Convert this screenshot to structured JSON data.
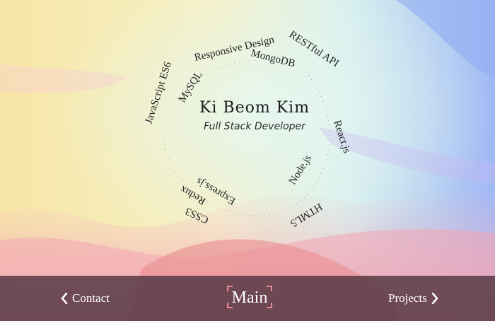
{
  "profile": {
    "name": "Ki Beom Kim",
    "role": "Full Stack Developer"
  },
  "skills": [
    "JavaScript ES6",
    "MySQL",
    "Responsive Design",
    "MongoDB",
    "RESTful API",
    "React.js",
    "Node.js",
    "HTML5",
    "Express.js",
    "Redux",
    "CSS3"
  ],
  "nav": {
    "left_label": "Contact",
    "center_label": "Main",
    "right_label": "Projects",
    "left_icon": "chevron-left-icon",
    "right_icon": "chevron-right-icon"
  },
  "colors": {
    "nav_bar": "#503440",
    "accent": "#e58b9a"
  }
}
